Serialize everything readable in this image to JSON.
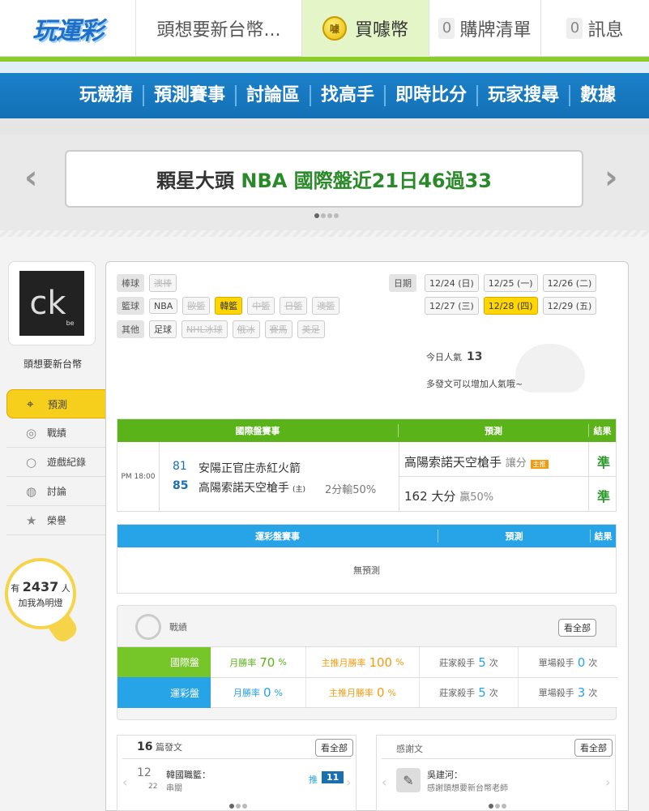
{
  "topbar": {
    "logo": "玩運彩",
    "user": "頭想要新台幣...",
    "buy_label": "買噱幣",
    "coin_glyph": "噱",
    "cart_count": "0",
    "cart_label": "購牌清單",
    "msg_count": "0",
    "msg_label": "訊息"
  },
  "nav": [
    "玩競猜",
    "預測賽事",
    "討論區",
    "找高手",
    "即時比分",
    "玩家搜尋",
    "數據"
  ],
  "banner": {
    "prefix": "顆星大頭",
    "highlight": "NBA 國際盤近21日46過33"
  },
  "profile": {
    "name": "頭想要新台幣",
    "avatar_text": "ck",
    "avatar_sub": "be"
  },
  "menu": [
    {
      "label": "預測",
      "icon": "⌖"
    },
    {
      "label": "戰績",
      "icon": "◎"
    },
    {
      "label": "遊戲紀錄",
      "icon": "○"
    },
    {
      "label": "討論",
      "icon": "◍"
    },
    {
      "label": "榮譽",
      "icon": "★"
    }
  ],
  "fans": {
    "prefix": "有",
    "count": "2437",
    "suffix": "人",
    "text": "加我為明燈"
  },
  "filters": {
    "baseball_label": "棒球",
    "baseball": [
      "澳棒"
    ],
    "basketball_label": "籃球",
    "basketball": [
      "NBA",
      "歐籃",
      "韓籃",
      "中籃",
      "日籃",
      "澳籃"
    ],
    "other_label": "其他",
    "other": [
      "足球",
      "NHL冰球",
      "俄冰",
      "賽馬",
      "美足"
    ],
    "date_label": "日期",
    "dates_row1": [
      "12/24 (日)",
      "12/25 (一)",
      "12/26 (二)"
    ],
    "dates_row2": [
      "12/27 (三)",
      "12/28 (四)",
      "12/29 (五)"
    ]
  },
  "popularity": {
    "label": "今日人氣",
    "value": "13",
    "note": "多發文可以增加人氣哦~"
  },
  "intl_table": {
    "headers": [
      "國際盤賽事",
      "預測",
      "結果"
    ],
    "time": "PM 18:00",
    "team1_score": "81",
    "team1_name": "安陽正官庄赤紅火箭",
    "team2_score": "85",
    "team2_name": "高陽索諾天空槍手",
    "home_mark": "(主)",
    "spread_result": "2分輸50%",
    "pick1": "高陽索諾天空槍手",
    "pick1_type": "讓分",
    "pick1_badge": "主推",
    "pick1_result": "準",
    "pick2": "162 大分",
    "pick2_note": "贏50%",
    "pick2_result": "準"
  },
  "lottery_table": {
    "headers": [
      "運彩盤賽事",
      "預測",
      "結果"
    ],
    "empty": "無預測"
  },
  "record": {
    "title": "戰績",
    "more": "看全部",
    "rows": [
      {
        "tag": "國際盤",
        "color": "#76c62a",
        "month_label": "月勝率",
        "month": "70",
        "main_label": "主推月勝率",
        "main": "100",
        "pct": "%",
        "banker_label": "莊家殺手",
        "banker": "5",
        "single_label": "單場殺手",
        "single": "0",
        "unit": "次"
      },
      {
        "tag": "運彩盤",
        "color": "#27a3e8",
        "month_label": "月勝率",
        "month": "0",
        "main_label": "主推月勝率",
        "main": "0",
        "pct": "%",
        "banker_label": "莊家殺手",
        "banker": "5",
        "single_label": "單場殺手",
        "single": "3",
        "unit": "次"
      }
    ]
  },
  "posts": {
    "count": "16",
    "label": "篇發文",
    "more": "看全部",
    "month": "12",
    "day": "22",
    "title": "韓國職籃：",
    "sub": "串關",
    "push": "推",
    "push_count": "11"
  },
  "thanks": {
    "label": "感謝文",
    "more": "看全部",
    "author": "吳建河：",
    "text": "感謝頭想要新台幣老師"
  }
}
